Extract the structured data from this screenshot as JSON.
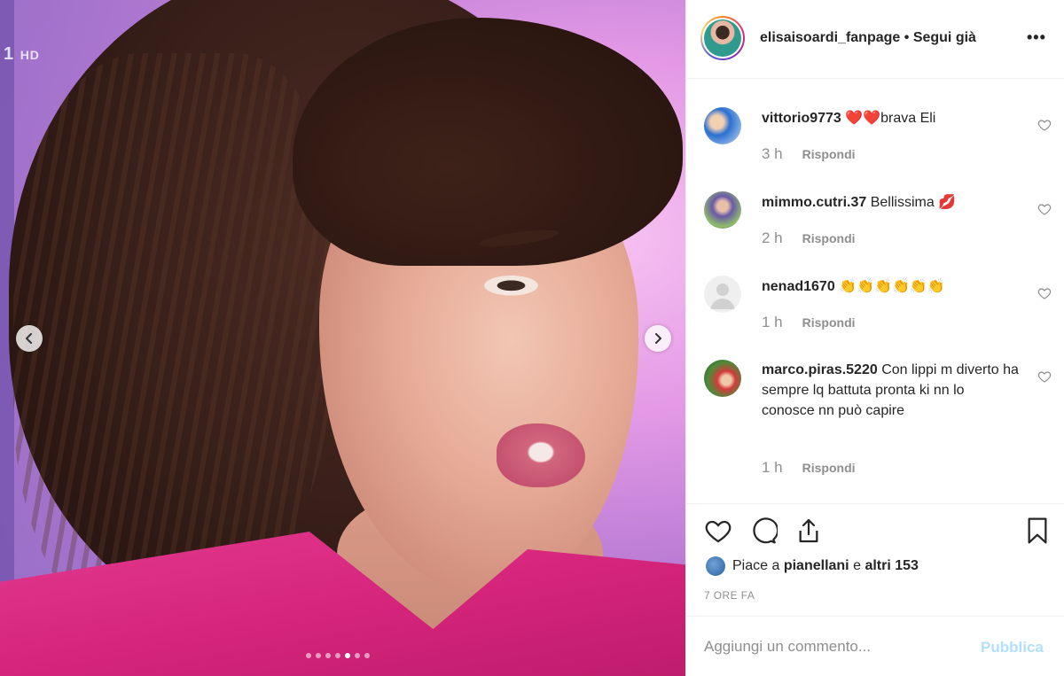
{
  "photo": {
    "channel_logo": "1",
    "channel_logo_suffix": "HD",
    "carousel_dots": 7,
    "carousel_active_index": 4
  },
  "header": {
    "username": "elisaisoardi_fanpage",
    "separator": "•",
    "follow_status": "Segui già",
    "more_label": "•••"
  },
  "comments": [
    {
      "user": "vittorio9773",
      "text": "❤️❤️brava Eli",
      "time": "3 h",
      "reply": "Rispondi"
    },
    {
      "user": "mimmo.cutri.37",
      "text": "Bellissima 💋",
      "time": "2 h",
      "reply": "Rispondi"
    },
    {
      "user": "nenad1670",
      "text": "👏👏👏👏👏👏",
      "time": "1 h",
      "reply": "Rispondi"
    },
    {
      "user": "marco.piras.5220",
      "text": "Con lippi m diverto ha sempre lq battuta pronta ki nn lo conosce nn può capire",
      "time": "1 h",
      "reply": "Rispondi"
    }
  ],
  "likes": {
    "prefix": "Piace a",
    "user": "pianellani",
    "middle": "e",
    "others": "altri 153"
  },
  "time_ago": "7 ORE FA",
  "add_comment": {
    "placeholder": "Aggiungi un commento...",
    "publish_label": "Pubblica"
  },
  "colors": {
    "text": "#262626",
    "muted": "#8e8e8e",
    "border": "#efefef",
    "publish_disabled": "#b2dffc"
  }
}
